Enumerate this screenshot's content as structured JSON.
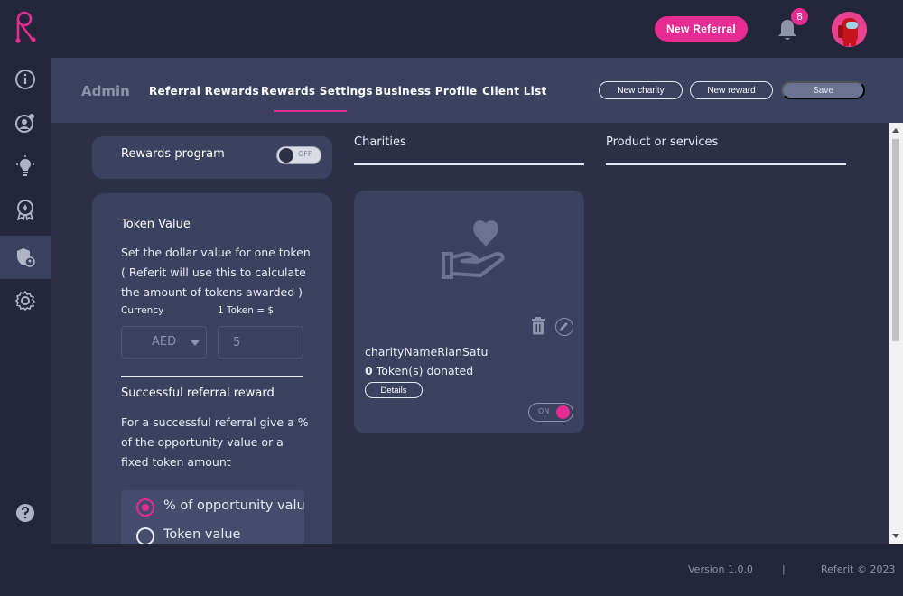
{
  "header": {
    "new_referral_label": "New Referral",
    "notification_count": "8"
  },
  "sidebar": {
    "items": [
      {
        "icon": "info-gauge-icon"
      },
      {
        "icon": "user-share-icon"
      },
      {
        "icon": "lightbulb-icon"
      },
      {
        "icon": "award-badge-icon"
      },
      {
        "icon": "shield-user-icon",
        "active": true
      },
      {
        "icon": "gear-icon"
      },
      {
        "icon": "help-icon"
      },
      {
        "icon": "info-icon"
      }
    ]
  },
  "tabs": {
    "admin": "Admin",
    "items": [
      {
        "label": "Referral Rewards"
      },
      {
        "label": "Rewards Settings",
        "active": true
      },
      {
        "label": "Business Profile"
      },
      {
        "label": "Client List"
      }
    ]
  },
  "actions": {
    "new_charity": "New charity",
    "new_reward": "New reward",
    "save": "Save"
  },
  "rewards_program": {
    "label": "Rewards program",
    "toggle": "OFF"
  },
  "token_value": {
    "title": "Token Value",
    "desc": "Set the dollar value for one token ( Referit will use this to calculate the amount of tokens awarded )",
    "currency_label": "Currency",
    "rate_label": "1 Token = $",
    "currency_value": "AED",
    "rate_value": "5"
  },
  "referral_reward": {
    "title": "Successful referral reward",
    "desc": "For a successful referral give a % of the opportunity value or a fixed token amount",
    "options": [
      {
        "label": "% of opportunity value",
        "selected": true
      },
      {
        "label": "Token value",
        "selected": false
      }
    ]
  },
  "columns": {
    "charities": "Charities",
    "products": "Product or services"
  },
  "charity": {
    "name": "charityNameRianSatu",
    "token_count": "0",
    "token_suffix": " Token(s) donated",
    "details": "Details",
    "toggle": "ON"
  },
  "footer": {
    "version": "Version 1.0.0",
    "separator": "|",
    "copyright": "Referit © 2023"
  },
  "colors": {
    "accent": "#e62b93",
    "background": "#232739",
    "panel": "#3b4260",
    "main": "#2c3148"
  }
}
